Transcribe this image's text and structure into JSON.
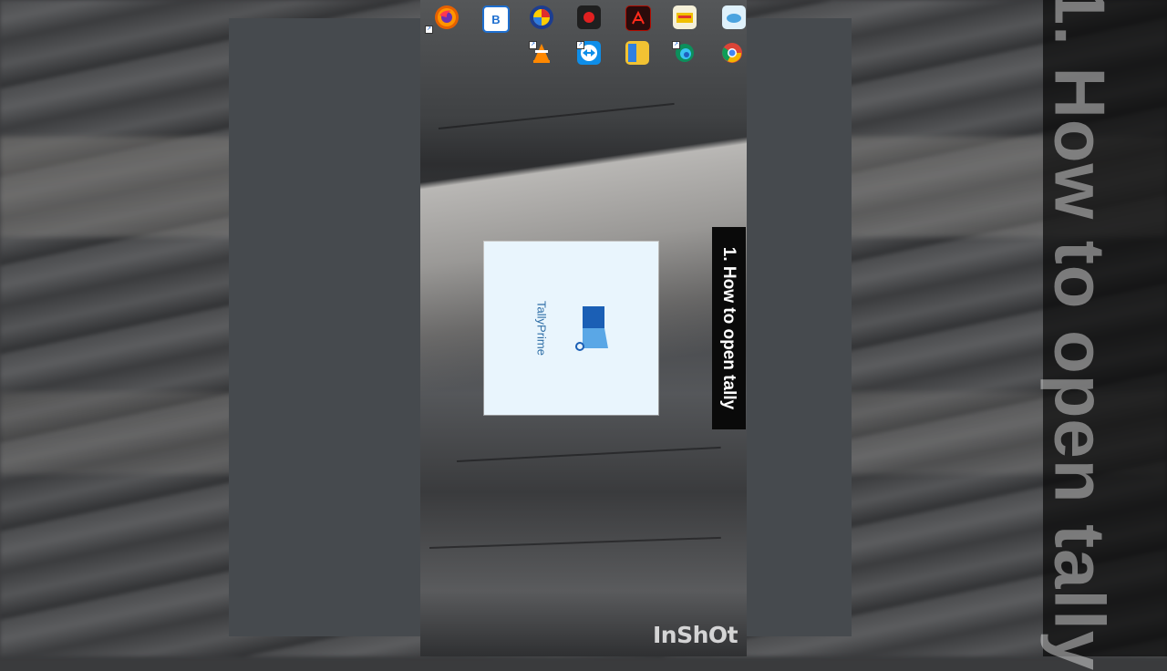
{
  "caption": "1. How to open tally",
  "tile": {
    "label": "TallyPrime"
  },
  "watermark": "InShOt",
  "desktop_icons": [
    {
      "name": "firefox-icon",
      "label": "Firefox",
      "color": "#e66000"
    },
    {
      "name": "bravo-icon",
      "label": "B",
      "color": "#1e6fd0"
    },
    {
      "name": "multicolor-app-icon",
      "label": "",
      "color": "#7a2aa0"
    },
    {
      "name": "record-icon",
      "label": "",
      "color": "#222222"
    },
    {
      "name": "adobe-reader-icon",
      "label": "",
      "color": "#b30b00"
    },
    {
      "name": "folder-app-icon",
      "label": "",
      "color": "#f0c000"
    },
    {
      "name": "cloud-app-icon",
      "label": "",
      "color": "#4aa3df"
    },
    {
      "name": "vlc-icon",
      "label": "",
      "color": "#ff8800"
    },
    {
      "name": "teamviewer-icon",
      "label": "",
      "color": "#0e8ee9"
    },
    {
      "name": "tallyprime-desktop-icon",
      "label": "",
      "color": "#f2c233"
    },
    {
      "name": "edge-icon",
      "label": "",
      "color": "#0c8f5c"
    },
    {
      "name": "chrome-icon",
      "label": "",
      "color": "#db4437"
    }
  ],
  "colors": {
    "tile_bg": "#e9f5fd",
    "tally_dark_blue": "#1b5fb5",
    "tally_light_blue": "#5aa7e6"
  }
}
